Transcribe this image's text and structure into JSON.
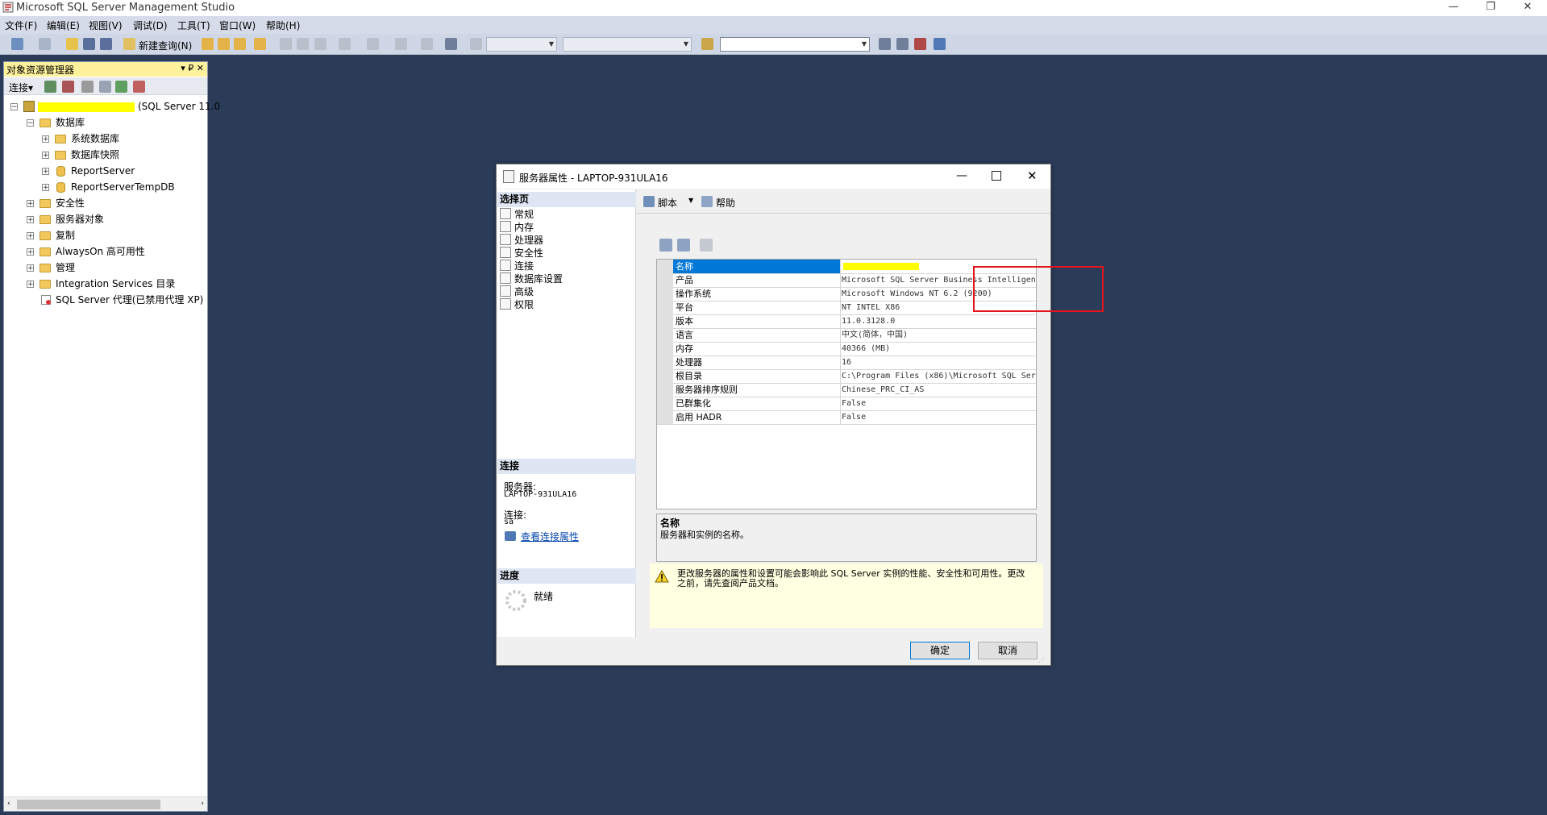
{
  "app": {
    "title": "Microsoft SQL Server Management Studio"
  },
  "window_controls": {
    "minimize": "—",
    "restore": "❐",
    "close": "✕"
  },
  "menu": [
    "文件(F)",
    "编辑(E)",
    "视图(V)",
    "调试(D)",
    "工具(T)",
    "窗口(W)",
    "帮助(H)"
  ],
  "toolbar": {
    "new_query": "新建查询(N)"
  },
  "object_explorer": {
    "title": "对象资源管理器",
    "pin": "▾ ₽ ✕",
    "connect": "连接▾",
    "server_suffix": "(SQL Server 11.0",
    "nodes": {
      "databases": "数据库",
      "system_databases": "系统数据库",
      "db_snapshots": "数据库快照",
      "report_server": "ReportServer",
      "report_server_temp": "ReportServerTempDB",
      "security": "安全性",
      "server_objects": "服务器对象",
      "replication": "复制",
      "alwayson": "AlwaysOn 高可用性",
      "management": "管理",
      "integration_services": "Integration Services 目录",
      "sql_agent": "SQL Server 代理(已禁用代理 XP)"
    }
  },
  "dialog": {
    "title": "服务器属性 - LAPTOP-931ULA16",
    "select_page_header": "选择页",
    "pages": [
      "常规",
      "内存",
      "处理器",
      "安全性",
      "连接",
      "数据库设置",
      "高级",
      "权限"
    ],
    "connection_header": "连接",
    "server_label": "服务器:",
    "server_value": "LAPTOP-931ULA16",
    "connection_label": "连接:",
    "connection_value": "sa",
    "view_conn_props": "查看连接属性",
    "progress_header": "进度",
    "progress_status": "就绪",
    "script_btn": "脚本",
    "help_btn": "帮助",
    "properties": [
      {
        "key": "名称",
        "value": ""
      },
      {
        "key": "产品",
        "value": "Microsoft SQL Server Business Intelligen"
      },
      {
        "key": "操作系统",
        "value": "Microsoft Windows NT 6.2 (9200)"
      },
      {
        "key": "平台",
        "value": "NT INTEL X86"
      },
      {
        "key": "版本",
        "value": "11.0.3128.0"
      },
      {
        "key": "语言",
        "value": "中文(简体，中国)"
      },
      {
        "key": "内存",
        "value": "40366 (MB)"
      },
      {
        "key": "处理器",
        "value": "16"
      },
      {
        "key": "根目录",
        "value": "C:\\Program Files (x86)\\Microsoft SQL Ser"
      },
      {
        "key": "服务器排序规则",
        "value": "Chinese_PRC_CI_AS"
      },
      {
        "key": "已群集化",
        "value": "False"
      },
      {
        "key": "启用 HADR",
        "value": "False"
      }
    ],
    "desc_title": "名称",
    "desc_text": "服务器和实例的名称。",
    "warning_text": "更改服务器的属性和设置可能会影响此 SQL Server 实例的性能、安全性和可用性。更改之前，请先查阅产品文档。",
    "ok": "确定",
    "cancel": "取消"
  },
  "colors": {
    "workspace": "#2b3c59",
    "highlight": "#0078d7",
    "redact": "#ffff00",
    "callout": "#e4141c"
  }
}
